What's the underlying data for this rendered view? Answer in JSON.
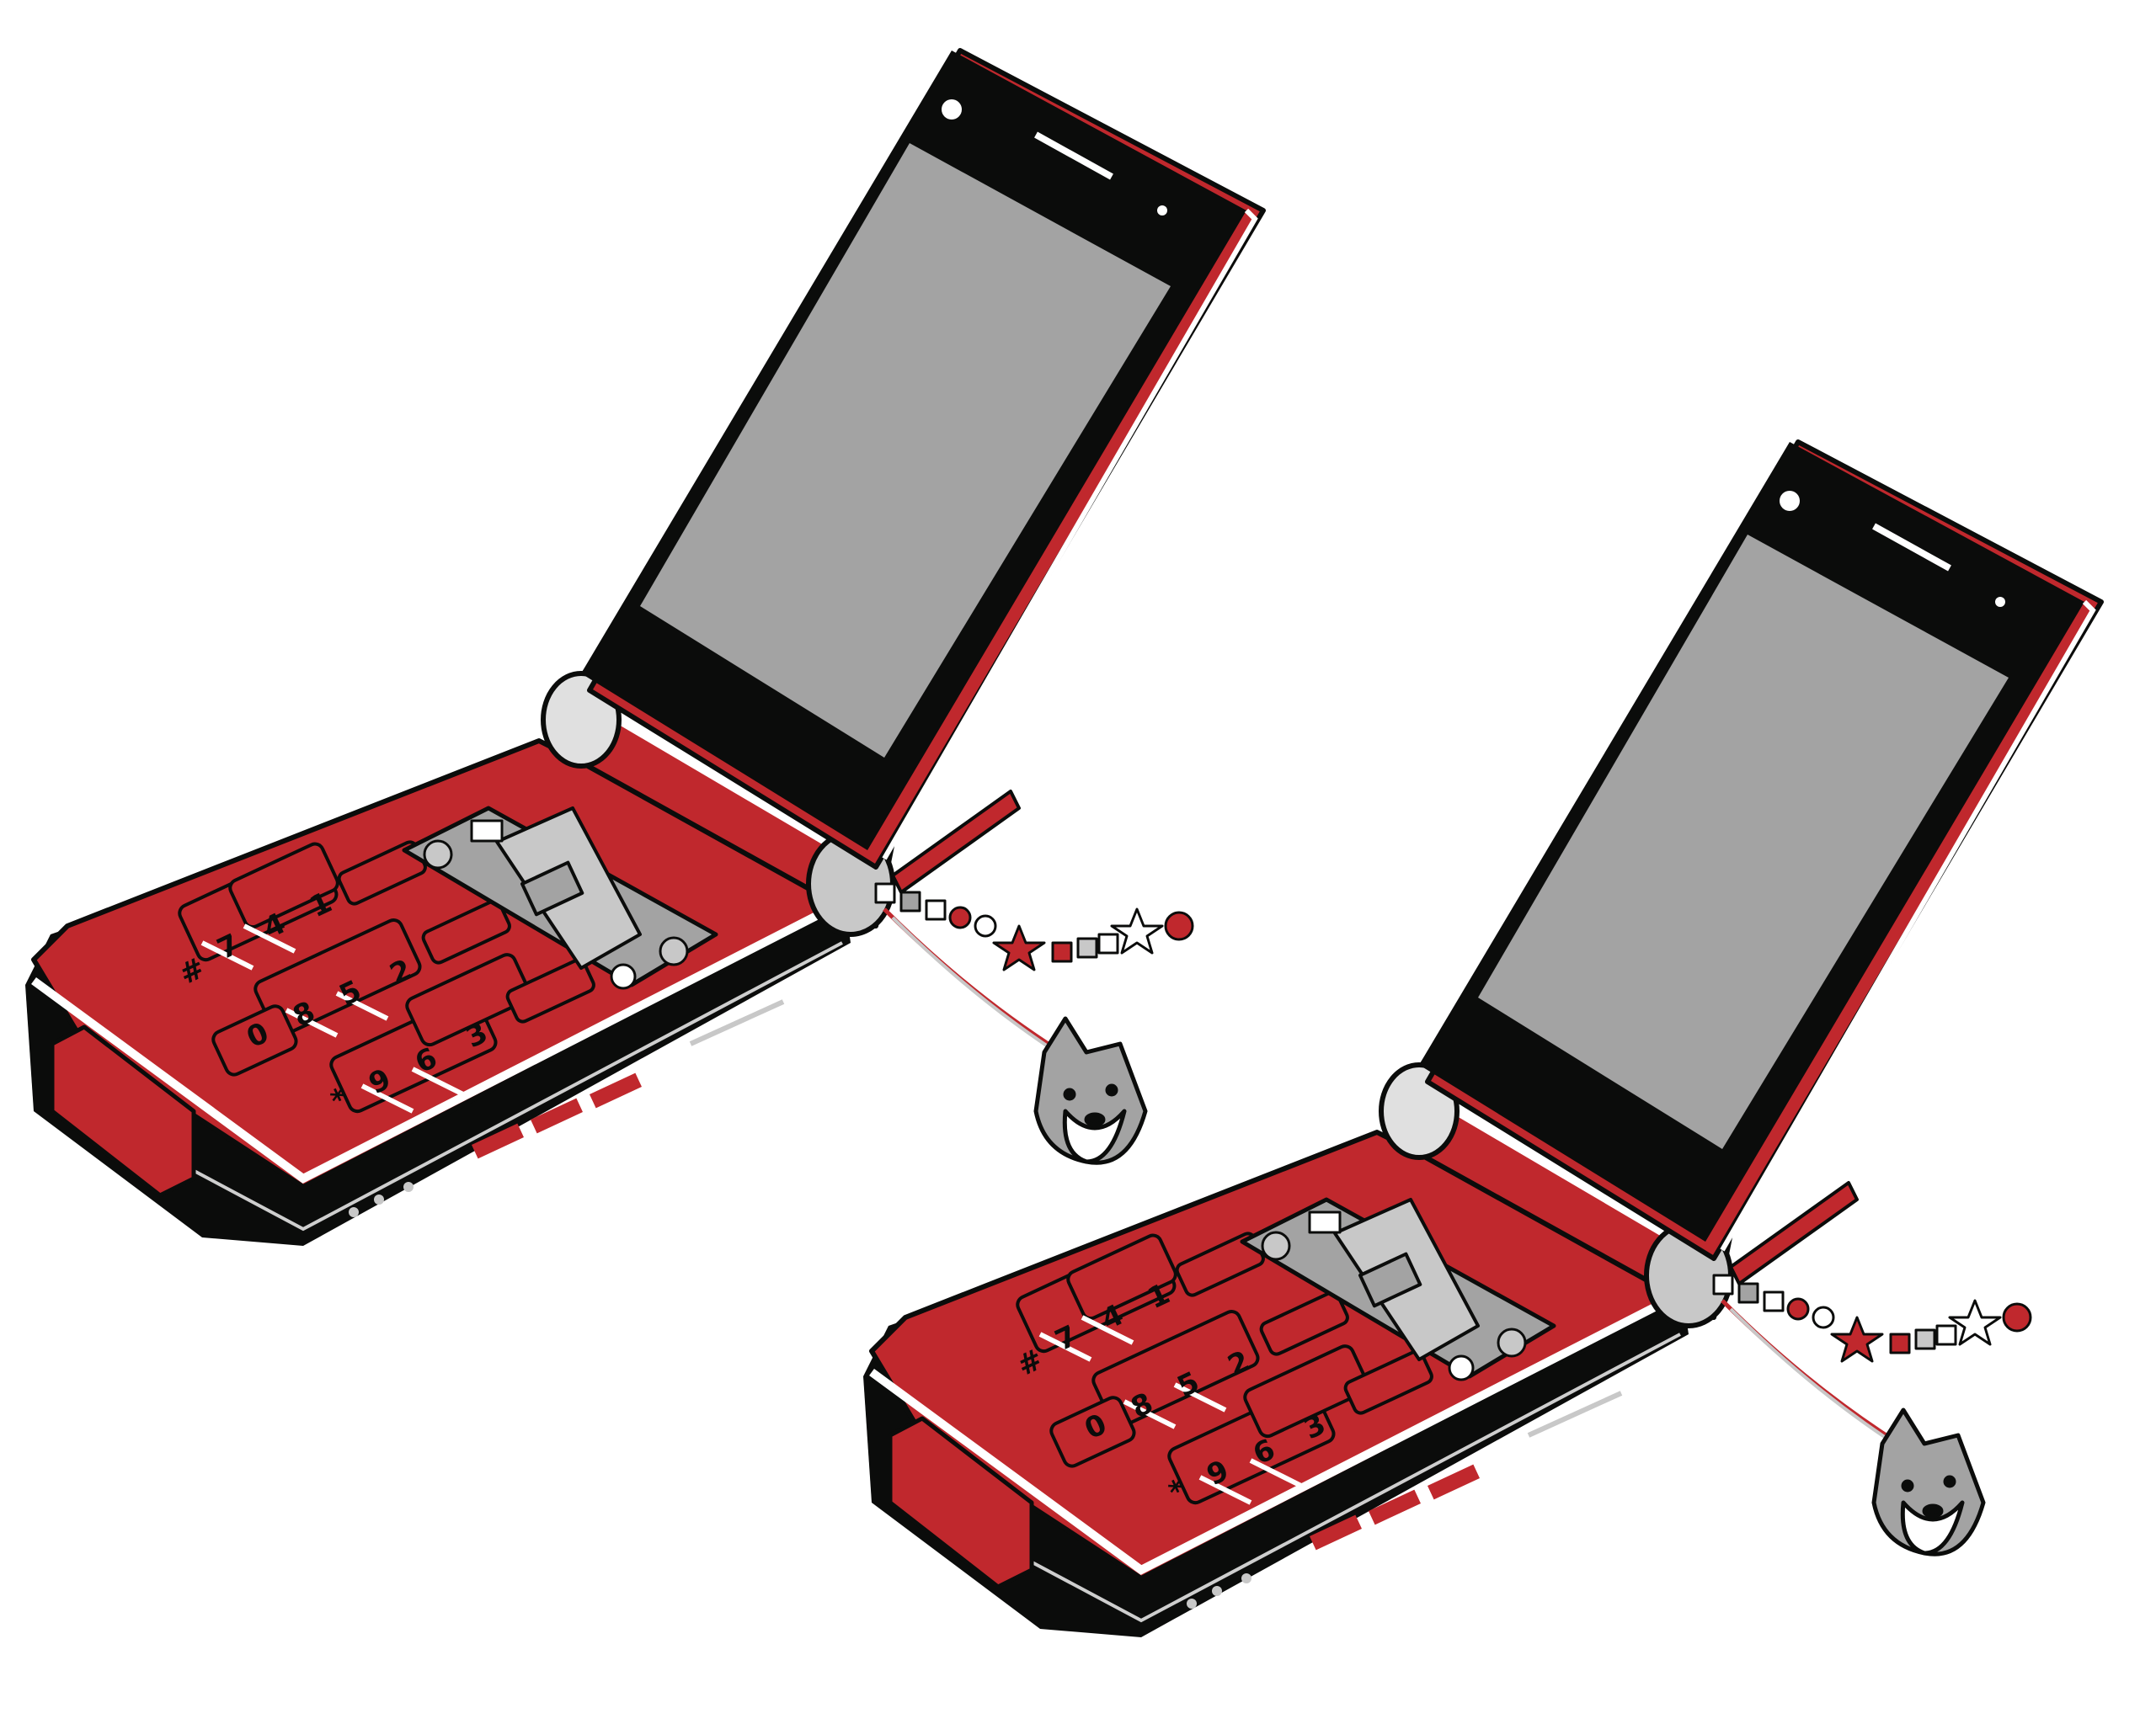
{
  "colors": {
    "body_red": "#c0282d",
    "dark_red": "#8f1b1f",
    "ink": "#0b0c0b",
    "screen_gray": "#a3a3a3",
    "silver": "#c8c8c8",
    "white": "#ffffff"
  },
  "phones": [
    {
      "name": "flip-phone-left",
      "keypad": {
        "digits": [
          "1",
          "2",
          "3",
          "4",
          "5",
          "6",
          "7",
          "8",
          "9",
          "0"
        ],
        "symbols": [
          "#",
          "*"
        ]
      },
      "media_icons": [
        "play-pause-icon",
        "fast-forward-icon",
        "rewind-icon"
      ],
      "nav_icons": [
        "call-icon",
        "envelope-icon",
        "end-call-icon",
        "camera-icon"
      ],
      "charm": "shiba-dog-charm"
    },
    {
      "name": "flip-phone-right",
      "keypad": {
        "digits": [
          "1",
          "2",
          "3",
          "4",
          "5",
          "6",
          "7",
          "8",
          "9",
          "0"
        ],
        "symbols": [
          "#",
          "*"
        ]
      },
      "media_icons": [
        "play-pause-icon",
        "fast-forward-icon",
        "rewind-icon"
      ],
      "nav_icons": [
        "call-icon",
        "envelope-icon",
        "end-call-icon",
        "camera-icon"
      ],
      "charm": "shiba-dog-charm"
    }
  ]
}
